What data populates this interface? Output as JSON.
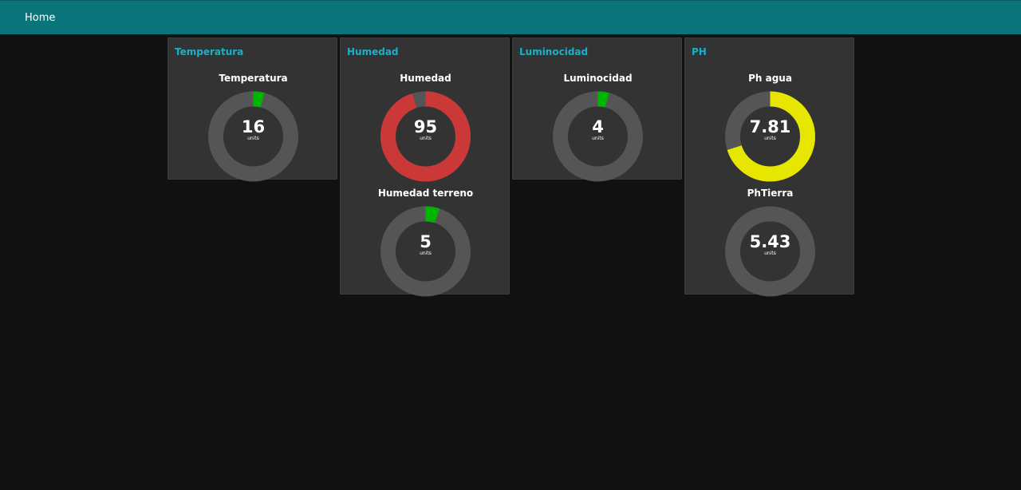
{
  "toolbar": {
    "title": "Home"
  },
  "colors": {
    "toolbar": "#097479",
    "group_title": "#1bb0c7",
    "track": "#555555",
    "green": "#00b500",
    "red": "#ca3838",
    "yellow": "#e6e600"
  },
  "groups": [
    {
      "title": "Temperatura",
      "gauges": [
        {
          "label": "Temperatura",
          "value": "16",
          "units": "units",
          "fill_fraction": 0.04,
          "fill_color": "green"
        }
      ]
    },
    {
      "title": "Humedad",
      "gauges": [
        {
          "label": "Humedad",
          "value": "95",
          "units": "units",
          "fill_fraction": 0.95,
          "fill_color": "red"
        },
        {
          "label": "Humedad terreno",
          "value": "5",
          "units": "units",
          "fill_fraction": 0.05,
          "fill_color": "green"
        }
      ]
    },
    {
      "title": "Luminocidad",
      "gauges": [
        {
          "label": "Luminocidad",
          "value": "4",
          "units": "units",
          "fill_fraction": 0.04,
          "fill_color": "green"
        }
      ]
    },
    {
      "title": "PH",
      "gauges": [
        {
          "label": "Ph agua",
          "value": "7.81",
          "units": "units",
          "fill_fraction": 0.7,
          "fill_color": "yellow"
        },
        {
          "label": "PhTierra",
          "value": "5.43",
          "units": "units",
          "fill_fraction": 0,
          "fill_color": "green"
        }
      ]
    }
  ]
}
